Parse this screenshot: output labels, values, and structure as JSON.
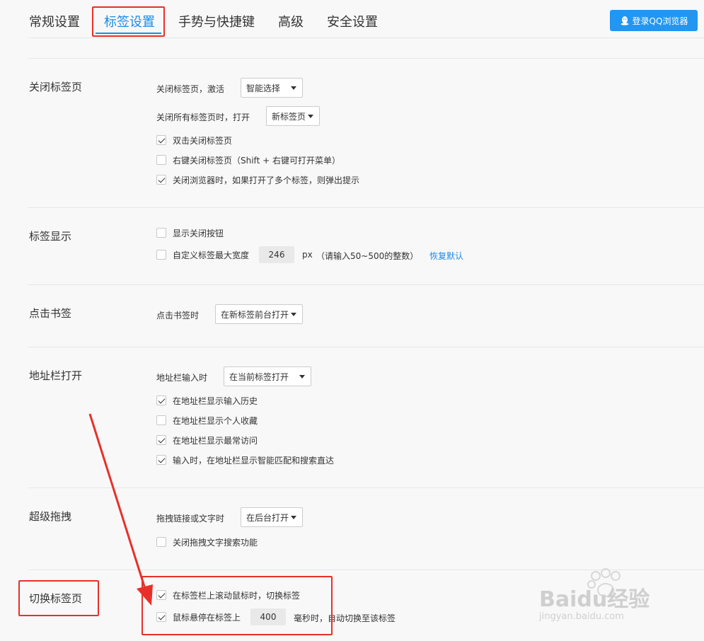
{
  "tabs": {
    "general": "常规设置",
    "tab_settings": "标签设置",
    "gestures": "手势与快捷键",
    "advanced": "高级",
    "security": "安全设置"
  },
  "login_button": "登录QQ浏览器",
  "close_tab": {
    "title": "关闭标签页",
    "activate_label": "关闭标签页，激活",
    "activate_value": "智能选择",
    "close_all_label": "关闭所有标签页时，打开",
    "close_all_value": "新标签页",
    "opt_double_click": "双击关闭标签页",
    "opt_right_click": "右键关闭标签页（Shift + 右键可打开菜单）",
    "opt_warn_multi": "关闭浏览器时，如果打开了多个标签，则弹出提示"
  },
  "tab_display": {
    "title": "标签显示",
    "opt_show_close": "显示关闭按钮",
    "opt_custom_width": "自定义标签最大宽度",
    "width_value": "246",
    "width_unit": "px",
    "width_hint": "（请输入50~500的整数）",
    "restore_default": "恢复默认"
  },
  "bookmark_click": {
    "title": "点击书签",
    "label": "点击书签时",
    "value": "在新标签前台打开"
  },
  "address_bar": {
    "title": "地址栏打开",
    "label": "地址栏输入时",
    "value": "在当前标签打开",
    "opt_history": "在地址栏显示输入历史",
    "opt_favorites": "在地址栏显示个人收藏",
    "opt_frequent": "在地址栏显示最常访问",
    "opt_smart": "输入时，在地址栏显示智能匹配和搜索直达"
  },
  "super_drag": {
    "title": "超级拖拽",
    "label": "拖拽链接或文字时",
    "value": "在后台打开",
    "opt_disable_search": "关闭拖拽文字搜索功能"
  },
  "switch_tab": {
    "title": "切换标签页",
    "opt_scroll": "在标签栏上滚动鼠标时，切换标签",
    "opt_hover_prefix": "鼠标悬停在标签上",
    "hover_ms": "400",
    "opt_hover_suffix": "毫秒时，自动切换至该标签"
  },
  "checkbox_states": {
    "double_click": true,
    "right_click": false,
    "warn_multi": true,
    "show_close": false,
    "custom_width": false,
    "history": true,
    "favorites": false,
    "frequent": true,
    "smart": true,
    "disable_drag_search": false,
    "scroll_switch": true,
    "hover_switch": true
  },
  "watermark": {
    "logo": "Baidu经验",
    "url": "jingyan.baidu.com"
  },
  "colors": {
    "accent": "#1a8ce8",
    "annotation": "#e8302a",
    "login_bg": "#2196f3"
  }
}
